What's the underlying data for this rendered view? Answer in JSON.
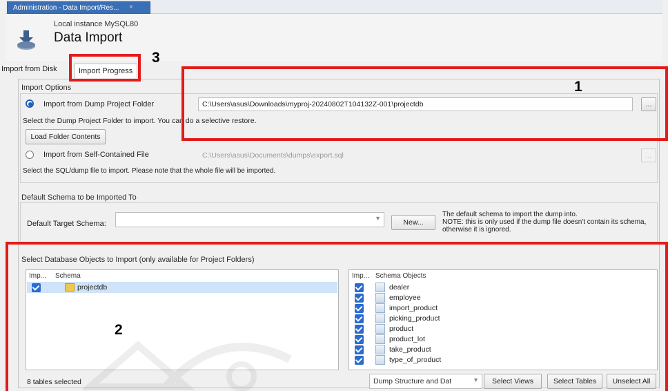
{
  "window": {
    "tab_title": "Administration - Data Import/Res...",
    "tab_close": "×"
  },
  "header": {
    "connection": "Local instance MySQL80",
    "title": "Data Import"
  },
  "tabs": {
    "import_from_disk": "Import from Disk",
    "import_progress": "Import Progress"
  },
  "import_options": {
    "group_label": "Import Options",
    "dump_folder": {
      "label": "Import from Dump Project Folder",
      "path": "C:\\Users\\asus\\Downloads\\myproj-20240802T104132Z-001\\projectdb",
      "browse": "...",
      "hint": "Select the Dump Project Folder to import. You can do a selective restore.",
      "load_button": "Load Folder Contents"
    },
    "self_contained": {
      "label": "Import from Self-Contained File",
      "path": "C:\\Users\\asus\\Documents\\dumps\\export.sql",
      "browse": "...",
      "hint": "Select the SQL/dump file to import. Please note that the whole file will be imported."
    }
  },
  "default_schema": {
    "group_label": "Default Schema to be Imported To",
    "target_label": "Default Target Schema:",
    "target_value": "",
    "new_button": "New...",
    "note": [
      "The default schema to import the dump into.",
      "NOTE: this is only used if the dump file doesn't contain its schema,",
      "otherwise it is ignored."
    ]
  },
  "objects": {
    "group_label": "Select Database Objects to Import (only available for Project Folders)",
    "schema_list": {
      "headers": [
        "Imp...",
        "Schema"
      ],
      "rows": [
        {
          "checked": true,
          "name": "projectdb"
        }
      ]
    },
    "objects_list": {
      "headers": [
        "Imp...",
        "Schema Objects"
      ],
      "rows": [
        {
          "checked": true,
          "name": "dealer"
        },
        {
          "checked": true,
          "name": "employee"
        },
        {
          "checked": true,
          "name": "import_product"
        },
        {
          "checked": true,
          "name": "picking_product"
        },
        {
          "checked": true,
          "name": "product"
        },
        {
          "checked": true,
          "name": "product_lot"
        },
        {
          "checked": true,
          "name": "take_product"
        },
        {
          "checked": true,
          "name": "type_of_product"
        }
      ]
    },
    "status": "8 tables selected",
    "dump_mode": "Dump Structure and Dat",
    "select_views": "Select Views",
    "select_tables": "Select Tables",
    "unselect_all": "Unselect All"
  },
  "annotations": {
    "box1": "1",
    "box2": "2",
    "box3": "3"
  },
  "colors": {
    "tab_blue": "#3a6fb5",
    "annotation_red": "#e21b1b",
    "checkbox_blue": "#2a6bd0",
    "selection": "#cfe3f9"
  }
}
